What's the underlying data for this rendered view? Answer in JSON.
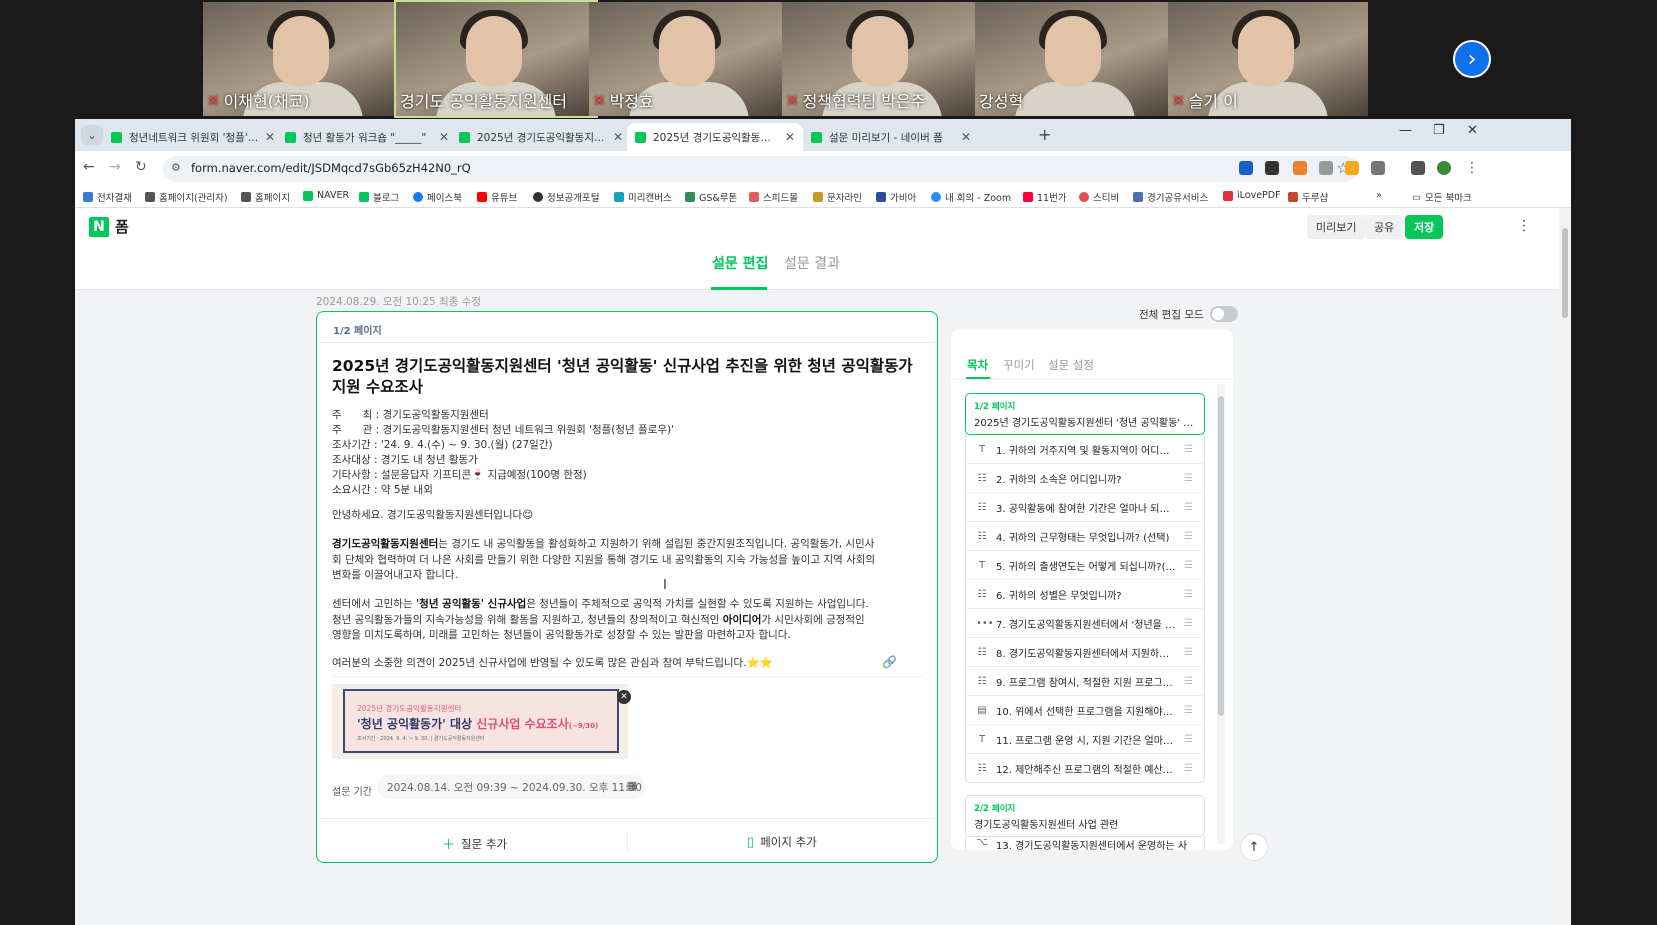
{
  "zoom": {
    "participants": [
      {
        "name": "이채현(채쿄)",
        "muted": true
      },
      {
        "name": "경기도 공익활동지원센터",
        "muted": false,
        "active": true
      },
      {
        "name": "박정효",
        "muted": true
      },
      {
        "name": "정책협력팀 박은주",
        "muted": true
      },
      {
        "name": "강성혁",
        "muted": false
      },
      {
        "name": "슬기 이",
        "muted": true
      }
    ],
    "next_icon": "chevron-right-icon"
  },
  "browser": {
    "tabs": [
      {
        "title": "청년네트워크 위원회 '청플' 의"
      },
      {
        "title": "청년 활동가 워크숍 \"_____\""
      },
      {
        "title": "2025년 경기도공익활동지원센"
      },
      {
        "title": "2025년 경기도공익활동지원센",
        "active": true
      },
      {
        "title": "설문 미리보기 - 네이버 폼"
      }
    ],
    "url": "form.naver.com/edit/JSDMqcd7sGb65zH42N0_rQ",
    "bookmarks": [
      "전자결재",
      "홈페이지(관리자)",
      "홈페이지",
      "NAVER",
      "블로그",
      "페이스북",
      "유튜브",
      "정보공개포털",
      "미리캔버스",
      "GS&루톤",
      "스피드몰",
      "문자라인",
      "가비아",
      "내 회의 - Zoom",
      "11번가",
      "스티비",
      "경기공유서비스",
      "iLovePDF",
      "두루샵"
    ],
    "all_bookmarks": "모든 북마크",
    "more": "»"
  },
  "app": {
    "logo": "N",
    "name": "폼",
    "preview": "미리보기",
    "share": "공유",
    "save": "저장",
    "main_tabs": [
      "설문 편집",
      "설문 결과"
    ],
    "modified": "2024.08.29. 오전 10:25 최종 수정",
    "full_edit_mode": "전체 편집 모드"
  },
  "form": {
    "page_badge": "1/2 페이지",
    "title": "2025년 경기도공익활동지원센터 '청년 공익활동' 신규사업 추진을 위한 청년 공익활동가 지원 수요조사",
    "meta": [
      "주　　최 : 경기도공익활동지원센터",
      "주　　관 : 경기도공익활동지원센터 청년 네트워크 위원회 '청플(청년 플로우)'",
      "조사기간 : '24. 9. 4.(수) ~ 9. 30.(월) (27일간)",
      "조사대상 : 경기도 내 청년 활동가",
      "기타사항 : 설문응답자 기프티콘🍷 지급예정(100명 한정)",
      "소요시간 : 약 5분 내외"
    ],
    "greeting": "안녕하세요. 경기도공익활동지원센터입니다😊",
    "para1_bold": "경기도공익활동지원센터",
    "para1": "는 경기도 내 공익활동을 활성화하고 지원하기 위해 설립된 중간지원조직입니다. 공익활동가, 시민사회 단체와 협력하여 더 나은 사회를 만들기 위한 다양한 지원을 통해 경기도 내 공익활동의 지속 가능성을 높이고 지역 사회의 변화를 이끌어내고자 합니다.",
    "para2_a": "센터에서 고민하는 ",
    "para2_bold": "'청년 공익활동' 신규사업",
    "para2_b": "은 청년들이 주체적으로 공익적 가치를 실현할 수 있도록 지원하는 사업입니다. 청년 공익활동가들의 지속가능성을 위해 활동을 지원하고, 청년들의 창의적이고 혁신적인 ",
    "para2_bold2": "아이디어",
    "para2_c": "가 시민사회에 긍정적인 영향을 미치도록하며, 미래를 고민하는 청년들이 공익활동가로 성장할 수 있는 발판을 마련하고자 합니다.",
    "closing": "여러분의 소중한 의견이 2025년 신규사업에 반영될 수 있도록 많은 관심과 참여 부탁드립니다.⭐⭐",
    "banner": {
      "line1": "2025년 경기도공익활동지원센터",
      "line2": "'청년 공익활동가' 대상",
      "line2_accent": " 신규사업 수요조사",
      "line2_suffix": "(~9/30)",
      "line3": "조사기간 : 2024. 9. 4. ~ 9. 30. | 경기도공익활동지원센터"
    },
    "period_label": "설문 기간",
    "period": "2024.08.14. 오전 09:39 ~ 2024.09.30. 오후 11:30",
    "add_question": "질문 추가",
    "add_page": "페이지 추가"
  },
  "sidebar": {
    "tabs": [
      "목차",
      "꾸미기",
      "설문 설정"
    ],
    "page1": {
      "badge": "1/2 페이지",
      "name": "2025년 경기도공익활동지원센터 '청년 공익활동' 신규사업 추진을 위한"
    },
    "questions": [
      {
        "icon": "T",
        "text": "1. 귀하의 거주지역 및 활동지역이 어디십니까?"
      },
      {
        "icon": "☷",
        "text": "2. 귀하의 소속은 어디입니까?"
      },
      {
        "icon": "☷",
        "text": "3. 공익활동에 참여한 기간은 얼마나 되십니까?"
      },
      {
        "icon": "☷",
        "text": "4. 귀하의 근무형태는 무엇입니까? (선택)"
      },
      {
        "icon": "T",
        "text": "5. 귀하의 출생연도는 어떻게 되십니까?(단위"
      },
      {
        "icon": "☷",
        "text": "6. 귀하의 성별은 무엇입니까?"
      },
      {
        "icon": "•••",
        "text": "7. 경기도공익활동지원센터에서 '청년을 대상"
      },
      {
        "icon": "☷",
        "text": "8. 경기도공익활동지원센터에서 지원하는 청"
      },
      {
        "icon": "☷",
        "text": "9. 프로그램 참여시, 적절한 지원 프로그램 방"
      },
      {
        "icon": "▤",
        "text": "10. 위에서 선택한 프로그램을 지원해야하는"
      },
      {
        "icon": "T",
        "text": "11. 프로그램 운영 시, 지원 기간은 얼마나 되"
      },
      {
        "icon": "☷",
        "text": "12. 제안해주신 프로그램의 적절한 예산은 어"
      }
    ],
    "page2": {
      "badge": "2/2 페이지",
      "name": "경기도공익활동지원센터 사업 관련"
    },
    "q13": "13. 경기도공익활동지원센터에서 운영하는 사"
  }
}
